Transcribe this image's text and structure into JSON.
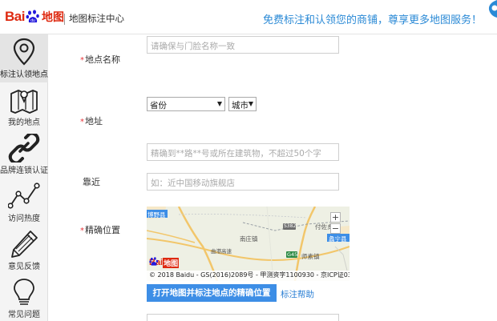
{
  "header": {
    "logo_text": "Bai",
    "logo_ditu": "地图",
    "subtitle": "地图标注中心",
    "slogan": "免费标注和认领您的商铺，尊享更多地图服务！"
  },
  "sidebar": {
    "items": [
      {
        "label": "标注认领地点",
        "icon": "location-pin-icon",
        "active": true
      },
      {
        "label": "我的地点",
        "icon": "folded-map-icon",
        "active": false
      },
      {
        "label": "品牌连锁认证",
        "icon": "chain-link-icon",
        "active": false
      },
      {
        "label": "访问热度",
        "icon": "line-chart-icon",
        "active": false
      },
      {
        "label": "意见反馈",
        "icon": "pencil-icon",
        "active": false
      },
      {
        "label": "常见问题",
        "icon": "lightbulb-icon",
        "active": false
      }
    ]
  },
  "form": {
    "name_label": "地点名称",
    "name_placeholder": "请确保与门脸名称一致",
    "address_label": "地址",
    "province_value": "省份",
    "city_value": "城市",
    "address_detail_placeholder": "精确到**路**号或所在建筑物，不超过50个字",
    "nearby_label": "靠近",
    "nearby_placeholder": "如：近中国移动旗舰店",
    "precise_label": "精确位置",
    "required_mark": "*"
  },
  "map": {
    "places": [
      "博野县",
      "付佐乡",
      "南庄镇",
      "曲港高速",
      "师素镇",
      "蠡宁县"
    ],
    "road_codes": [
      "S382",
      "G45"
    ],
    "zoom_in": "+",
    "zoom_out": "−",
    "logo_text": "Bai",
    "logo_ditu": "地图",
    "copyright": "© 2018 Baidu - GS(2016)2089号 - 甲测资字1100930 - 京ICP证03"
  },
  "actions": {
    "open_map_button": "打开地图并标注地点的精确位置",
    "help_link": "标注帮助"
  },
  "colors": {
    "brand_red": "#de2910",
    "brand_blue": "#2b8ad6",
    "button_blue": "#3d8ee6",
    "required_red": "#e8343a"
  }
}
